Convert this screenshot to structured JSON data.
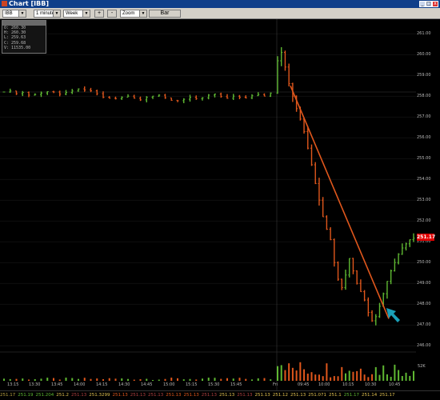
{
  "window": {
    "title": "Chart [IBB]"
  },
  "toolbar": {
    "symbol": "IBB",
    "interval": "1 minute",
    "range": "Week",
    "zoom_in": "+",
    "zoom_out": "-",
    "zoom": "Zoom",
    "bar_button": "Bar"
  },
  "ohlc_box": {
    "header": "",
    "open": "O: 260.30",
    "high": "H: 260.30",
    "low": "L: 259.63",
    "close": "C: 259.68",
    "volume": "V: 11535.00"
  },
  "last_price": "251.17",
  "volume_label": "52K",
  "y_ticks": [
    "261.00",
    "260.00",
    "259.00",
    "258.00",
    "257.00",
    "256.00",
    "255.00",
    "254.00",
    "253.00",
    "252.00",
    "251.00",
    "250.00",
    "249.00",
    "248.00",
    "247.00",
    "246.00"
  ],
  "x_ticks": [
    "13:15",
    "13:30",
    "13:45",
    "14:00",
    "14:15",
    "14:30",
    "14:45",
    "15:00",
    "15:15",
    "15:30",
    "15:45",
    "Fri",
    "09:45",
    "10:00",
    "10:15",
    "10:30",
    "10:45"
  ],
  "bottom_row": [
    "251.17",
    "251.19",
    "251.204",
    "251.2",
    "251.13",
    "251.3299",
    "251.13",
    "251.13",
    "251.13",
    "251.13",
    "251.13",
    "251.13",
    "251.13",
    "251.13",
    "251.13",
    "251.12",
    "251.13",
    "251.071",
    "251.1",
    "251.17",
    "251.14",
    "251.17"
  ],
  "colors": {
    "up": "#5fb832",
    "down": "#e0571c",
    "trendline": "#e0571c",
    "arrow": "#1aa0b8",
    "last_price_bg": "#e00000"
  },
  "chart_data": {
    "type": "ohlc",
    "y_range": [
      245.7,
      261.7
    ],
    "close_prices": [
      258.2,
      258.25,
      258.12,
      258.18,
      258.05,
      258.08,
      258.15,
      258.22,
      258.2,
      258.1,
      258.18,
      258.25,
      258.35,
      258.3,
      258.26,
      258.12,
      257.95,
      257.9,
      257.88,
      257.95,
      258.0,
      257.9,
      257.82,
      257.95,
      258.0,
      258.05,
      257.92,
      257.8,
      257.78,
      257.85,
      257.95,
      257.88,
      257.92,
      258.05,
      258.1,
      257.98,
      257.9,
      258.0,
      257.95,
      257.92,
      258.02,
      258.08,
      258.0,
      258.15,
      259.7,
      260.1,
      259.4,
      258.6,
      258.0,
      257.4,
      256.9,
      256.3,
      255.5,
      254.7,
      253.8,
      253.0,
      252.2,
      251.6,
      251.1,
      250.0,
      249.2,
      248.8,
      249.4,
      250.2,
      249.6,
      249.0,
      248.6,
      248.2,
      247.6,
      247.2,
      247.4,
      247.9,
      248.5,
      249.1,
      249.6,
      250.0,
      250.4,
      250.7,
      250.9,
      251.1,
      251.17
    ],
    "trendline": {
      "start_price": 258.5,
      "end_price": 247.3
    }
  }
}
